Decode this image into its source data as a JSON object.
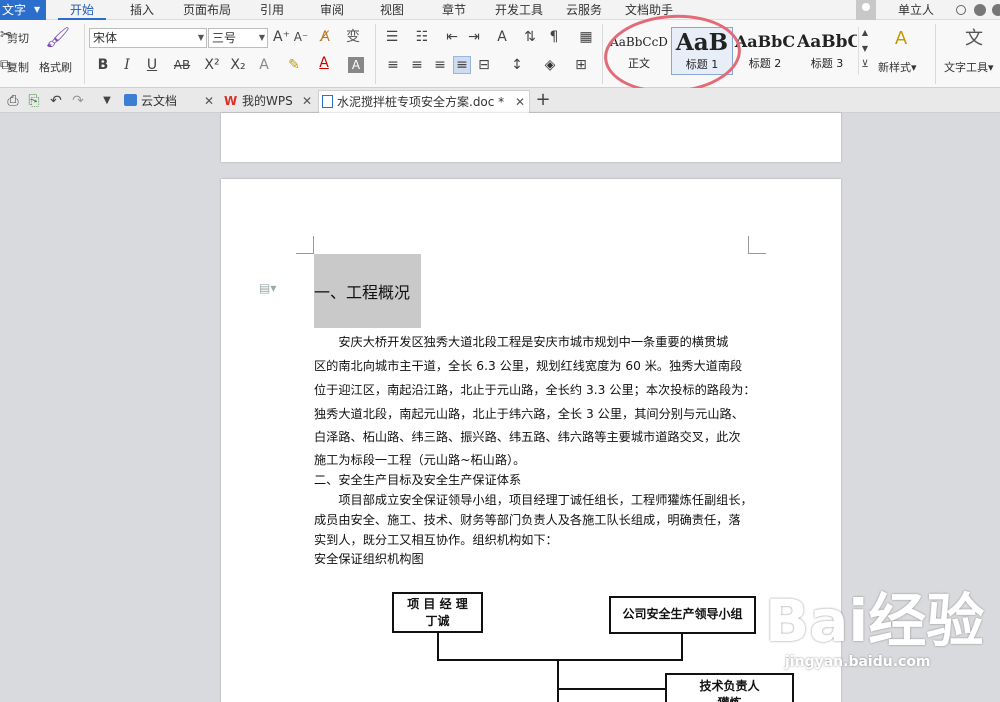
{
  "menubar": {
    "app_label": "文字",
    "tabs": [
      "开始",
      "插入",
      "页面布局",
      "引用",
      "审阅",
      "视图",
      "章节",
      "开发工具",
      "云服务",
      "文档助手"
    ],
    "user_name": "单立人"
  },
  "ribbon": {
    "cut": "剪切",
    "copy": "复制",
    "format_painter": "格式刷",
    "font_name": "宋体",
    "font_size": "三号",
    "styles": [
      {
        "preview": "AaBbCcD",
        "label": "正文"
      },
      {
        "preview": "AaB",
        "label": "标题 1"
      },
      {
        "preview": "AaBbC",
        "label": "标题 2"
      },
      {
        "preview": "AaBbC",
        "label": "标题 3"
      }
    ],
    "new_style": "新样式",
    "text_tools": "文字工具"
  },
  "tabsrow": {
    "tabs": [
      {
        "label": "云文档"
      },
      {
        "label": "我的WPS"
      },
      {
        "label": "水泥搅拌桩专项安全方案.doc *"
      }
    ],
    "add": "+"
  },
  "document": {
    "heading": "一、工程概况",
    "lines": [
      "　　安庆大桥开发区独秀大道北段工程是安庆市城市规划中一条重要的横贯城",
      "区的南北向城市主干道，全长 6.3 公里，规划红线宽度为 60 米。独秀大道南段",
      "位于迎江区，南起沿江路，北止于元山路，全长约 3.3 公里；本次投标的路段为：",
      "独秀大道北段，南起元山路，北止于纬六路，全长 3 公里，其间分别与元山路、",
      "白泽路、柘山路、纬三路、振兴路、纬五路、纬六路等主要城市道路交叉，此次",
      "施工为标段一工程（元山路~柘山路）。",
      "二、安全生产目标及安全生产保证体系",
      "　　项目部成立安全保证领导小组，项目经理丁诚任组长，工程师獾炼任副组长，",
      "成员由安全、施工、技术、财务等部门负责人及各施工队长组成，明确责任，落",
      "实到人，既分工又相互协作。组织机构如下：",
      "安全保证组织机构图"
    ],
    "org_chart": {
      "pm_line1": "项 目 经 理",
      "pm_line2": "丁诚",
      "company_group": "公司安全生产领导小组",
      "tech_line1": "技术负责人",
      "tech_line2": "獾炼"
    }
  },
  "watermark": {
    "brand": "Bai经验",
    "url": "jingyan.baidu.com"
  },
  "colors": {
    "accent": "#2c6ecb",
    "annotation_circle": "#e46a76"
  }
}
